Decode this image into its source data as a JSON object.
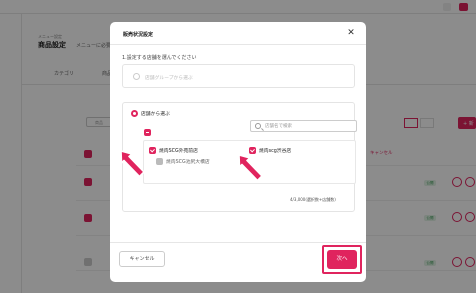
{
  "background": {
    "breadcrumb": "メニュー設定",
    "page_title": "商品設定",
    "page_subtitle": "メニューに必要",
    "tabs": [
      "カテゴリ",
      "商品"
    ],
    "search_placeholder": "商品",
    "new_button": "+ 新",
    "cancel_link": "キャンセル",
    "badge_text": "公開"
  },
  "modal": {
    "title": "販売状況設定",
    "instruction": "1.設定する店舗を選んでください",
    "option_group_label": "店舗グループから選ぶ",
    "option_store_label": "店舗から選ぶ",
    "store_search_placeholder": "店舗名で検索",
    "stores": [
      {
        "name": "焼肉SCG外苑前店",
        "checked": true
      },
      {
        "name": "焼肉scg渋谷店",
        "checked": true
      },
      {
        "name": "焼肉SCG池尻大橋店",
        "checked": false
      }
    ],
    "count_text": "4/3,000(選択数+店舗数)",
    "cancel_label": "キャンセル",
    "next_label": "次へ"
  },
  "colors": {
    "accent": "#e0245e",
    "overlay": "rgba(0,0,0,0.45)"
  }
}
